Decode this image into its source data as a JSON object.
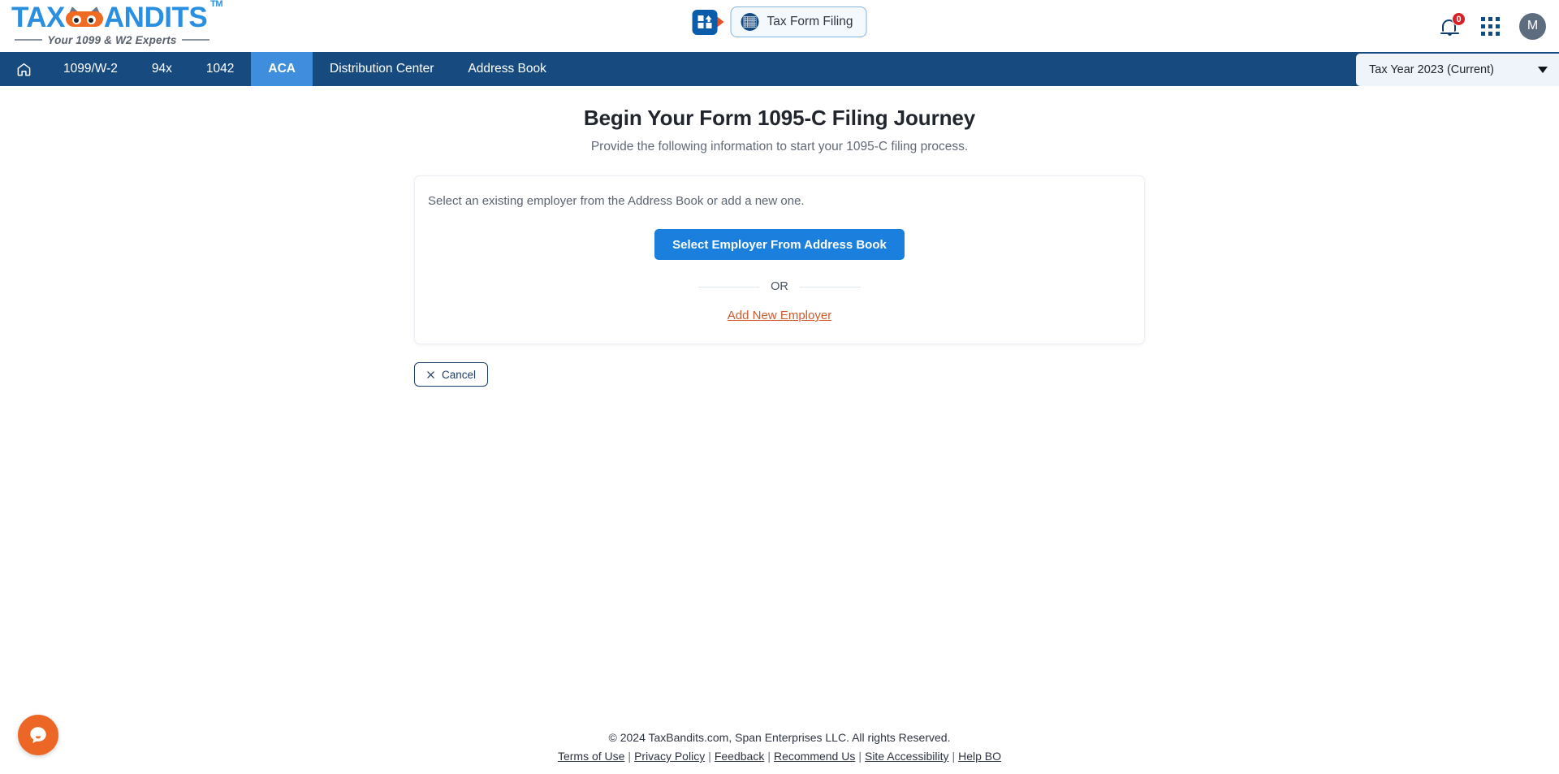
{
  "brand": {
    "logo_main_left": "TAX",
    "logo_main_right": "ANDITS",
    "logo_tm": "TM",
    "logo_tagline": "Your 1099 & W2 Experts",
    "accent_blue": "#2a8fe0",
    "accent_orange": "#ef6b23"
  },
  "header": {
    "app_switcher_icon": "apps-switch-icon",
    "filing_button_label": "Tax Form Filing",
    "filing_button_icon": "irs-seal-icon",
    "notifications": {
      "icon": "bell-icon",
      "count": "0",
      "badge_color": "#d82026"
    },
    "apps_grid_icon": "grid-dots-icon",
    "avatar_initial": "M"
  },
  "nav": {
    "items": [
      {
        "name": "home",
        "label": "",
        "icon": "home-icon",
        "active": false
      },
      {
        "name": "1099-w2",
        "label": "1099/W-2",
        "active": false
      },
      {
        "name": "94x",
        "label": "94x",
        "active": false
      },
      {
        "name": "1042",
        "label": "1042",
        "active": false
      },
      {
        "name": "aca",
        "label": "ACA",
        "active": true
      },
      {
        "name": "distribution-center",
        "label": "Distribution Center",
        "active": false
      },
      {
        "name": "address-book",
        "label": "Address Book",
        "active": false
      }
    ],
    "active_color": "#3e8edd",
    "bar_color": "#174b80",
    "tax_year": {
      "value": "Tax Year 2023 (Current)",
      "icon": "chevron-down-icon"
    }
  },
  "main": {
    "title": "Begin Your Form 1095-C Filing Journey",
    "subtitle": "Provide the following information to start your 1095-C filing process.",
    "card": {
      "lead_text": "Select an existing employer from the Address Book or add a new one.",
      "primary_button": "Select Employer From Address Book",
      "primary_button_color": "#1b7fdd",
      "divider_text": "OR",
      "add_link": "Add New Employer",
      "add_link_color": "#cf5b2c"
    },
    "cancel_button": {
      "label": "Cancel",
      "icon": "close-x-icon"
    }
  },
  "footer": {
    "copyright": "© 2024 TaxBandits.com, Span Enterprises LLC. All rights Reserved.",
    "links": [
      "Terms of Use",
      "Privacy Policy",
      "Feedback",
      "Recommend Us",
      "Site Accessibility",
      "Help BO"
    ],
    "separator": "|"
  },
  "chat_widget": {
    "icon": "chat-bubble-icon",
    "color": "#ec6726"
  }
}
